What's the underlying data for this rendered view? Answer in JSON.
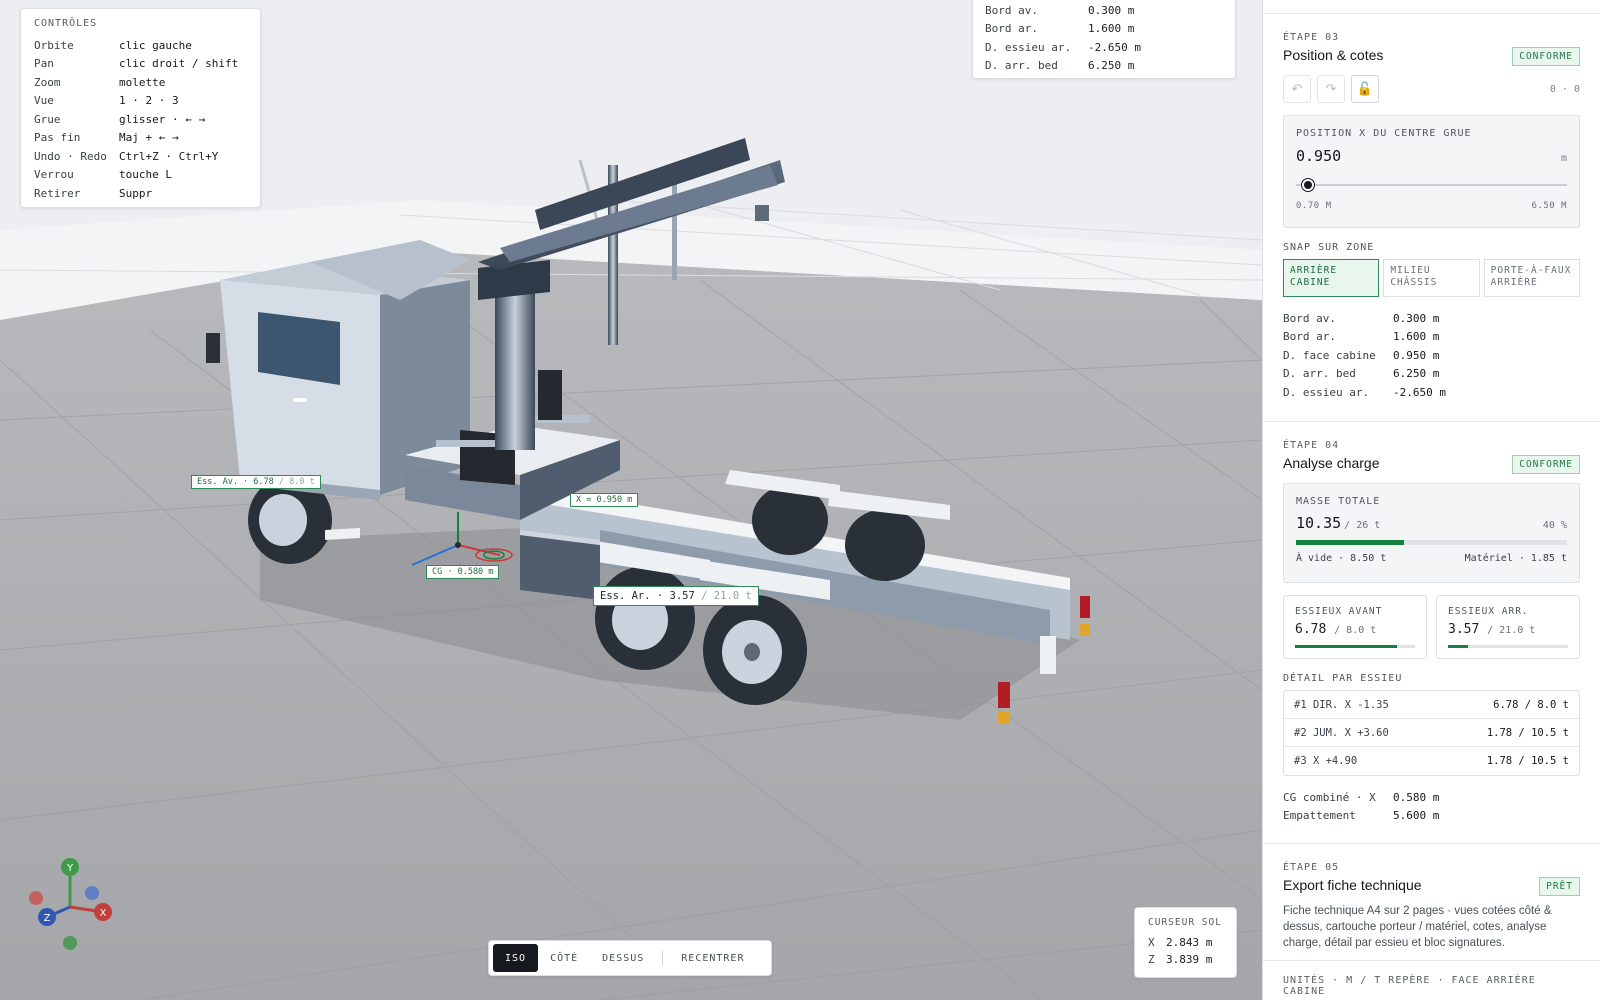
{
  "controls": {
    "title": "CONTRÔLES",
    "rows": [
      {
        "k": "Orbite",
        "v": "clic gauche"
      },
      {
        "k": "Pan",
        "v": "clic droit / shift"
      },
      {
        "k": "Zoom",
        "v": "molette"
      },
      {
        "k": "Vue",
        "v": "1 · 2 · 3"
      },
      {
        "k": "Grue",
        "v": "glisser · ← →"
      },
      {
        "k": "Pas fin",
        "v": "Maj + ← →"
      },
      {
        "k": "Undo · Redo",
        "v": "Ctrl+Z · Ctrl+Y"
      },
      {
        "k": "Verrou",
        "v": "touche L"
      },
      {
        "k": "Retirer",
        "v": "Suppr"
      }
    ]
  },
  "dims_overlay": {
    "rows": [
      {
        "k": "Bord av.",
        "v": "0.300 m"
      },
      {
        "k": "Bord ar.",
        "v": "1.600 m"
      },
      {
        "k": "D. essieu ar.",
        "v": "-2.650 m"
      },
      {
        "k": "D. arr. bed",
        "v": "6.250 m"
      }
    ]
  },
  "scene_tags": {
    "front_axle": {
      "label": "Ess. Av. · 6.78",
      "sub": "/ 8.0 t"
    },
    "x_pos": {
      "label": "X = 0.950 m"
    },
    "cg": {
      "label": "CG · 0.580 m"
    },
    "rear_axle": {
      "label": "Ess. Ar. · 3.57",
      "sub": "/ 21.0 t"
    }
  },
  "gizmo": {
    "y": "Y",
    "x": "X",
    "z": "Z"
  },
  "cursor": {
    "title": "CURSEUR SOL",
    "x_label": "X",
    "x_value": "2.843 m",
    "z_label": "Z",
    "z_value": "3.839 m"
  },
  "view_toolbar": {
    "iso": "ISO",
    "side": "CÔTÉ",
    "top": "DESSUS",
    "recenter": "RECENTRER"
  },
  "step3": {
    "label": "ÉTAPE 03",
    "title": "Position & cotes",
    "badge": "CONFORME",
    "undo_icon": "↶",
    "redo_icon": "↷",
    "lock_icon": "🔓",
    "counter": "0 · 0",
    "position": {
      "label": "POSITION X DU CENTRE GRUE",
      "value": "0.950",
      "unit": "m",
      "min": "0.70 M",
      "max": "6.50 M",
      "min_value": 0.7,
      "max_value": 6.5,
      "current_value": 0.95
    },
    "snap_label": "SNAP SUR ZONE",
    "snap": [
      {
        "line1": "ARRIÈRE",
        "line2": "CABINE"
      },
      {
        "line1": "MILIEU",
        "line2": "CHÂSSIS"
      },
      {
        "line1": "PORTE-À-FAUX",
        "line2": "ARRIÈRE"
      }
    ],
    "dims": [
      {
        "k": "Bord av.",
        "v": "0.300 m"
      },
      {
        "k": "Bord ar.",
        "v": "1.600 m"
      },
      {
        "k": "D. face cabine",
        "v": "0.950 m"
      },
      {
        "k": "D. arr. bed",
        "v": "6.250 m"
      },
      {
        "k": "D. essieu ar.",
        "v": "-2.650 m"
      }
    ]
  },
  "step4": {
    "label": "ÉTAPE 04",
    "title": "Analyse charge",
    "badge": "CONFORME",
    "mass": {
      "label": "MASSE TOTALE",
      "value": "10.35",
      "of": "/ 26 t",
      "pct": "40 %",
      "fill": 40,
      "empty": "À vide · 8.50 t",
      "equipment": "Matériel · 1.85 t"
    },
    "front": {
      "label": "ESSIEUX AVANT",
      "value": "6.78",
      "of": "/ 8.0 t",
      "fill": 85
    },
    "rear": {
      "label": "ESSIEUX ARR.",
      "value": "3.57",
      "of": "/ 21.0 t",
      "fill": 17
    },
    "detail_label": "DÉTAIL PAR ESSIEU",
    "detail": [
      {
        "l": "#1  DIR. X -1.35",
        "r": "6.78 / 8.0 t"
      },
      {
        "l": "#2  JUM. X +3.60",
        "r": "1.78 / 10.5 t"
      },
      {
        "l": "#3  X +4.90",
        "r": "1.78 / 10.5 t"
      }
    ],
    "summary": [
      {
        "k": "CG combiné · X",
        "v": "0.580 m"
      },
      {
        "k": "Empattement",
        "v": "5.600 m"
      }
    ]
  },
  "step5": {
    "label": "ÉTAPE 05",
    "title": "Export fiche technique",
    "badge": "PRÊT",
    "desc": "Fiche technique A4 sur 2 pages · vues cotées côté & dessus, cartouche porteur / matériel, cotes, analyse charge, détail par essieu et bloc signatures."
  },
  "footer": {
    "text": "UNITÉS · M / T REPÈRE · FACE ARRIÈRE CABINE"
  },
  "colors": {
    "accent": "#16803e",
    "dark": "#16191d",
    "badge_bg": "#e9f6ee"
  }
}
